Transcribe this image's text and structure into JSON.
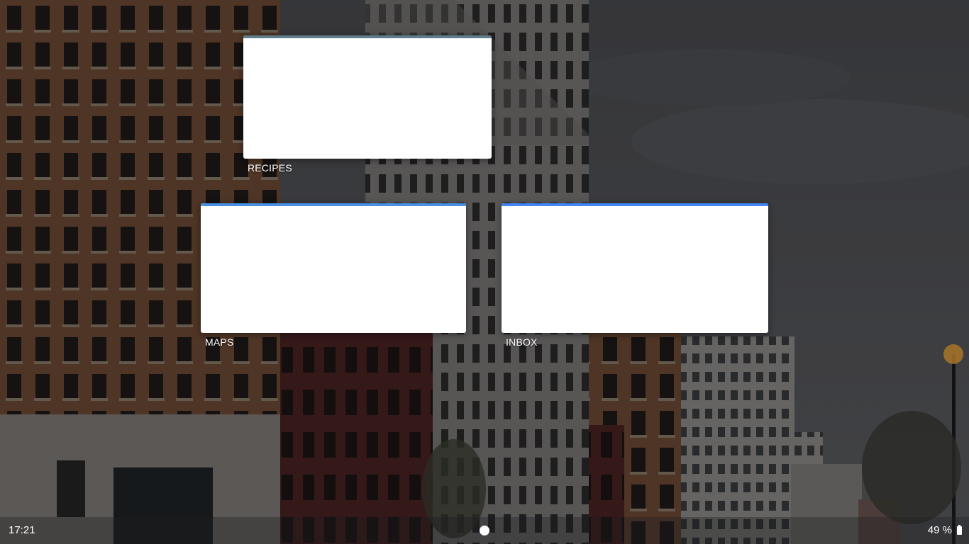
{
  "windows": [
    {
      "title": "RECIPES",
      "accent_color": "#607d8b"
    },
    {
      "title": "MAPS",
      "accent_color": "#4a90e2"
    },
    {
      "title": "INBOX",
      "accent_color": "#4285f4"
    }
  ],
  "shelf": {
    "time": "17:21",
    "battery_text": "49 %",
    "battery_icon": "battery-icon",
    "launcher_icon": "launcher-dot-icon"
  }
}
